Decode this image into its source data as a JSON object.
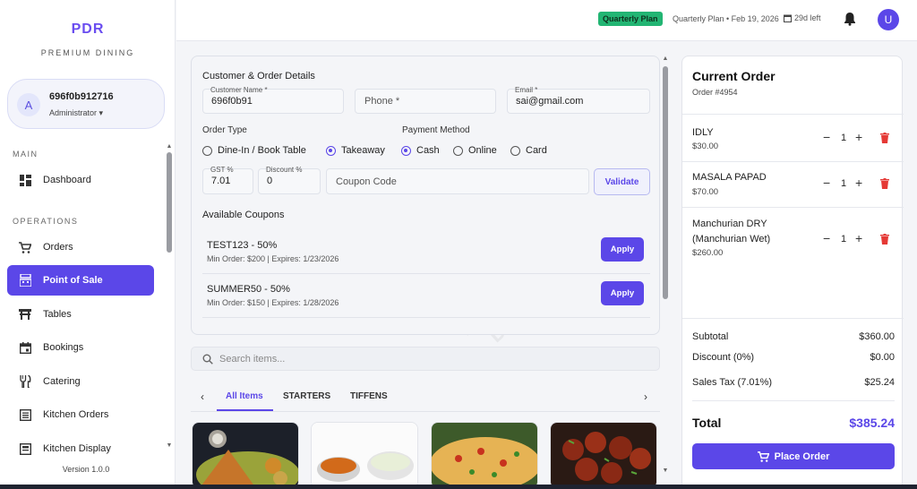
{
  "brand": {
    "logo": "PDR",
    "tagline": "PREMIUM DINING"
  },
  "user": {
    "initial": "A",
    "name": "696f0b912716",
    "role": "Administrator"
  },
  "sidebar": {
    "main_label": "MAIN",
    "operations_label": "OPERATIONS",
    "items": [
      {
        "label": "Dashboard",
        "icon": "dashboard-icon"
      },
      {
        "label": "Orders",
        "icon": "cart-icon"
      },
      {
        "label": "Point of Sale",
        "icon": "register-icon"
      },
      {
        "label": "Tables",
        "icon": "table-icon"
      },
      {
        "label": "Bookings",
        "icon": "calendar-icon"
      },
      {
        "label": "Catering",
        "icon": "utensils-icon"
      },
      {
        "label": "Kitchen Orders",
        "icon": "list-icon"
      },
      {
        "label": "Kitchen Display",
        "icon": "display-icon"
      }
    ],
    "version": "Version 1.0.0"
  },
  "topbar": {
    "plan_badge": "Quarterly Plan",
    "plan_info": "Quarterly Plan • Feb 19, 2026",
    "days_left": "29d left",
    "avatar_initial": "U"
  },
  "details": {
    "title": "Customer & Order Details",
    "customer_name_label": "Customer Name *",
    "customer_name_value": "696f0b91",
    "phone_placeholder": "Phone *",
    "email_label": "Email *",
    "email_value": "sai@gmail.com",
    "order_type_label": "Order Type",
    "order_types": [
      "Dine-In / Book Table",
      "Takeaway"
    ],
    "payment_label": "Payment Method",
    "payment_methods": [
      "Cash",
      "Online",
      "Card"
    ],
    "gst_label": "GST %",
    "gst_value": "7.01",
    "discount_label": "Discount %",
    "discount_value": "0",
    "coupon_placeholder": "Coupon Code",
    "validate_label": "Validate",
    "coupons_title": "Available Coupons",
    "coupons": [
      {
        "name": "TEST123 - 50%",
        "meta": "Min Order: $200 | Expires: 1/23/2026",
        "button": "Apply"
      },
      {
        "name": "SUMMER50 - 50%",
        "meta": "Min Order: $150 | Expires: 1/28/2026",
        "button": "Apply"
      }
    ]
  },
  "search": {
    "placeholder": "Search items..."
  },
  "categories": [
    "All Items",
    "STARTERS",
    "TIFFENS"
  ],
  "watermark": {
    "big": "PDR",
    "small1": "PREMIUM",
    "small2": "DINING"
  },
  "order": {
    "title": "Current Order",
    "number": "Order #4954",
    "items": [
      {
        "name": "IDLY",
        "price": "$30.00",
        "qty": "1"
      },
      {
        "name": "MASALA PAPAD",
        "price": "$70.00",
        "qty": "1"
      },
      {
        "name": "Manchurian DRY (Manchurian Wet)",
        "price": "$260.00",
        "qty": "1"
      }
    ],
    "subtotal_label": "Subtotal",
    "subtotal": "$360.00",
    "discount_label": "Discount (0%)",
    "discount": "$0.00",
    "tax_label": "Sales Tax (7.01%)",
    "tax": "$25.24",
    "total_label": "Total",
    "total": "$385.24",
    "place_label": "Place Order"
  },
  "colors": {
    "accent": "#5b47e8",
    "badge_green": "#22b573",
    "delete_red": "#e53935"
  }
}
